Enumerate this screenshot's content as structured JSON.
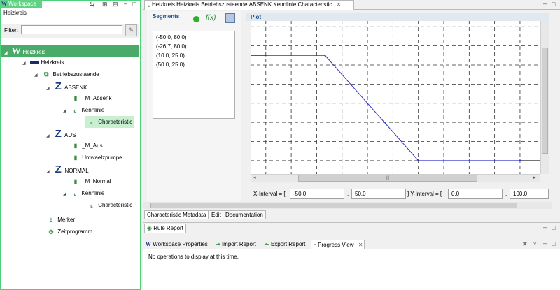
{
  "workspace": {
    "tab_label": "Workspace",
    "header": "Heizkreis",
    "filter_label": "Filter:",
    "filter_value": "",
    "tree": [
      {
        "label": "Heizkreis",
        "icon": "W",
        "depth": 0,
        "selected": true
      },
      {
        "label": "Heizkreis",
        "icon": "folder",
        "depth": 1
      },
      {
        "label": "Betriebszustaende",
        "icon": "states",
        "depth": 2
      },
      {
        "label": "ABSENK",
        "icon": "Z",
        "depth": 3
      },
      {
        "label": "_M_Absenk",
        "icon": "signal",
        "depth": 4
      },
      {
        "label": "Kennlinie",
        "icon": "chart",
        "depth": 4
      },
      {
        "label": "Characteristic",
        "icon": "chart",
        "depth": 5,
        "highlighted": true
      },
      {
        "label": "AUS",
        "icon": "Z",
        "depth": 3
      },
      {
        "label": "_M_Aus",
        "icon": "signal",
        "depth": 4
      },
      {
        "label": "Umwaelzpumpe",
        "icon": "signal",
        "depth": 4
      },
      {
        "label": "NORMAL",
        "icon": "Z",
        "depth": 3
      },
      {
        "label": "_M_Normal",
        "icon": "signal",
        "depth": 4
      },
      {
        "label": "Kennlinie",
        "icon": "chart",
        "depth": 4
      },
      {
        "label": "Characteristic",
        "icon": "chart",
        "depth": 5
      },
      {
        "label": "Merker",
        "icon": "merker",
        "depth": 2
      },
      {
        "label": "Zeitprogramm",
        "icon": "clock",
        "depth": 2
      }
    ]
  },
  "editor": {
    "tab_title": "Heizkreis.Heizkreis.Betriebszustaende.ABSENK.Kennlinie.Characteristic",
    "segments_label": "Segments",
    "fx_label": "f(x)",
    "segments": [
      "(-50.0, 80.0)",
      "(-26.7, 80.0)",
      "(10.0, 25.0)",
      "(50.0, 25.0)"
    ],
    "plot_label": "Plot",
    "x_interval_label": "X-Interval = [",
    "x_interval_min": "-50.0",
    "x_interval_max": "50.0",
    "sep": ",",
    "y_interval_label": "] Y-Interval = [",
    "y_interval_min": "0.0",
    "y_interval_max": "100.0",
    "subtabs": [
      "Characteristic Metadata",
      "Edit",
      "Documentation"
    ]
  },
  "chart_data": {
    "type": "line",
    "x": [
      -50.0,
      -26.7,
      10.0,
      50.0
    ],
    "y": [
      80.0,
      80.0,
      25.0,
      25.0
    ],
    "xlim": [
      -50.0,
      50.0
    ],
    "ylim": [
      0.0,
      100.0
    ],
    "grid": true,
    "line_color": "#3030c8"
  },
  "rule_report": {
    "tab_label": "Rule Report"
  },
  "bottom": {
    "tabs": [
      "Workspace Properties",
      "Import Report",
      "Export Report",
      "Progress View"
    ],
    "message": "No operations to display at this time."
  },
  "colors": {
    "workspace_accent": "#4fd07a",
    "selection": "#4aab68"
  }
}
